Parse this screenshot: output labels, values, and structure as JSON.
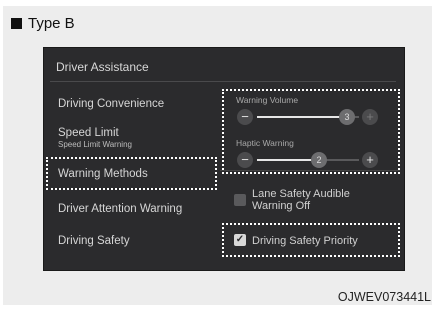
{
  "type_label": "Type B",
  "screen": {
    "title": "Driver Assistance",
    "menu": [
      {
        "label": "Driving Convenience",
        "sub": ""
      },
      {
        "label": "Speed Limit",
        "sub": "Speed Limit Warning"
      },
      {
        "label": "Warning Methods",
        "sub": ""
      },
      {
        "label": "Driver Attention Warning",
        "sub": ""
      },
      {
        "label": "Driving Safety",
        "sub": ""
      }
    ],
    "selected_menu": "Warning Methods",
    "warning_volume": {
      "label": "Warning Volume",
      "value": "3",
      "level_fraction": 0.9,
      "minus": "−",
      "plus": "+"
    },
    "haptic_warning": {
      "label": "Haptic Warning",
      "value": "2",
      "level_fraction": 0.6,
      "minus": "−",
      "plus": "+"
    },
    "lane_safety": {
      "label": "Lane Safety Audible Warning Off",
      "checked": false
    },
    "driving_safety_priority": {
      "label": "Driving Safety Priority",
      "checked": true,
      "check_glyph": "✓"
    }
  },
  "caption": "OJWEV073441L",
  "colors": {
    "screen_bg": "#2b2b2d",
    "highlight_border": "#ffffff",
    "figure_bg": "#ededed"
  }
}
